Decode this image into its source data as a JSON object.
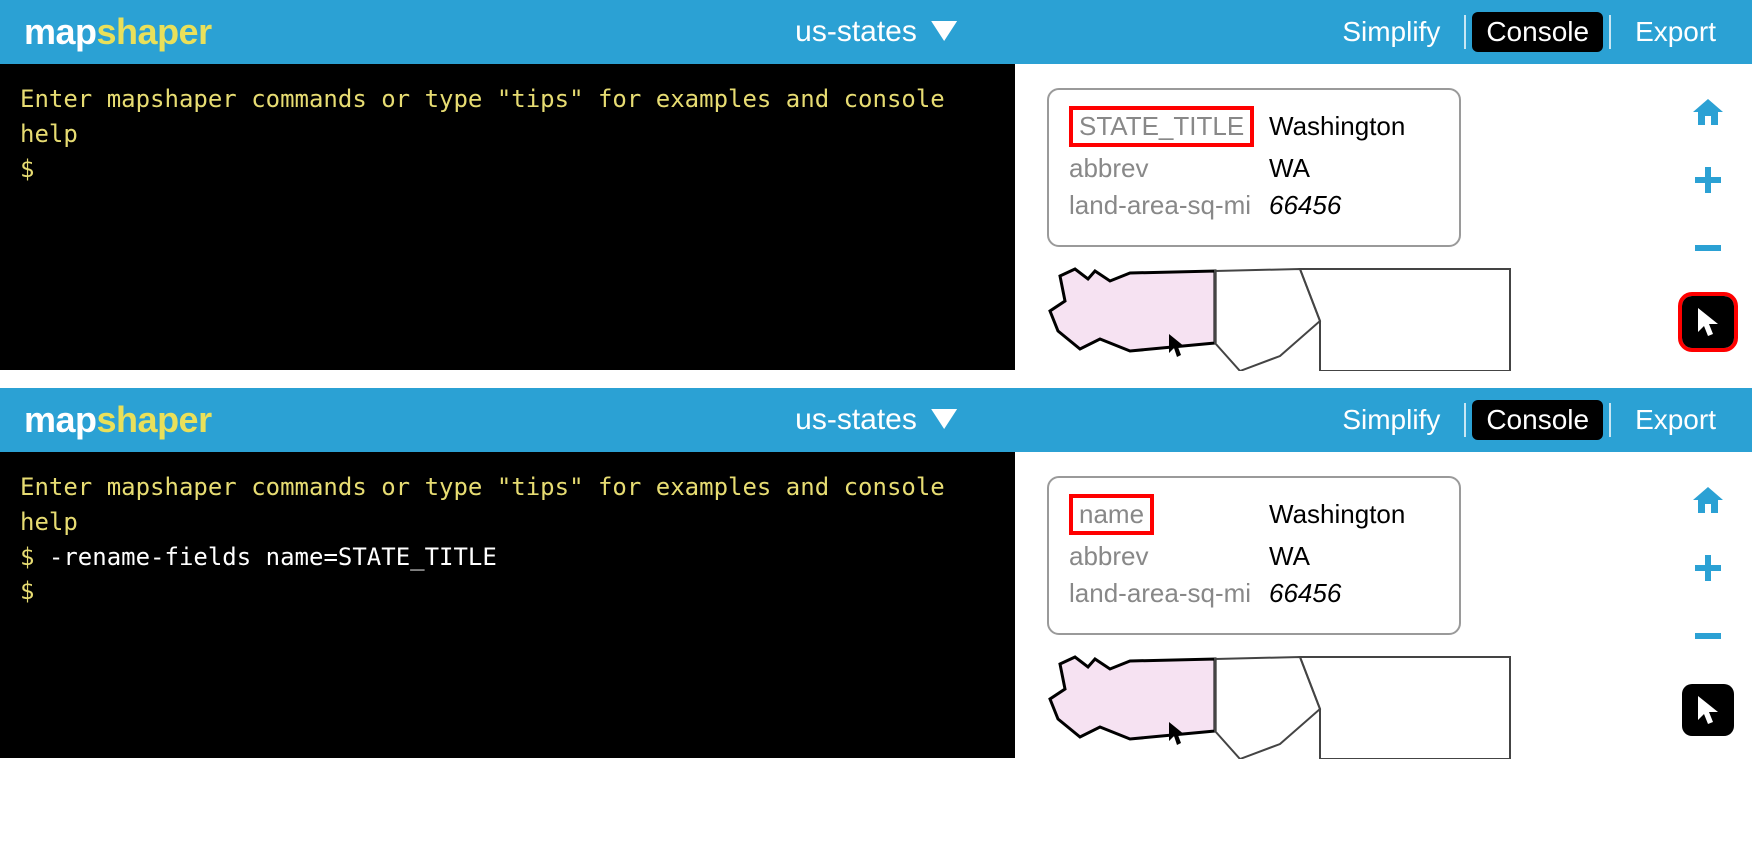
{
  "logo": {
    "a": "map",
    "b": "shaper"
  },
  "layer_name": "us-states",
  "header": {
    "simplify": "Simplify",
    "console": "Console",
    "export": "Export"
  },
  "console_hint": "Enter mapshaper commands or type \"tips\" for examples and console help",
  "prompt": "$",
  "panels": [
    {
      "command": "",
      "popup_rows": [
        {
          "key": "STATE_TITLE",
          "val": "Washington",
          "highlight": true,
          "italic": false
        },
        {
          "key": "abbrev",
          "val": "WA",
          "highlight": false,
          "italic": false
        },
        {
          "key": "land-area-sq-mi",
          "val": "66456",
          "highlight": false,
          "italic": true
        }
      ],
      "pointer_highlight": true
    },
    {
      "command": "-rename-fields name=STATE_TITLE",
      "popup_rows": [
        {
          "key": "name",
          "val": "Washington",
          "highlight": true,
          "italic": false
        },
        {
          "key": "abbrev",
          "val": "WA",
          "highlight": false,
          "italic": false
        },
        {
          "key": "land-area-sq-mi",
          "val": "66456",
          "highlight": false,
          "italic": true
        }
      ],
      "pointer_highlight": false
    }
  ]
}
